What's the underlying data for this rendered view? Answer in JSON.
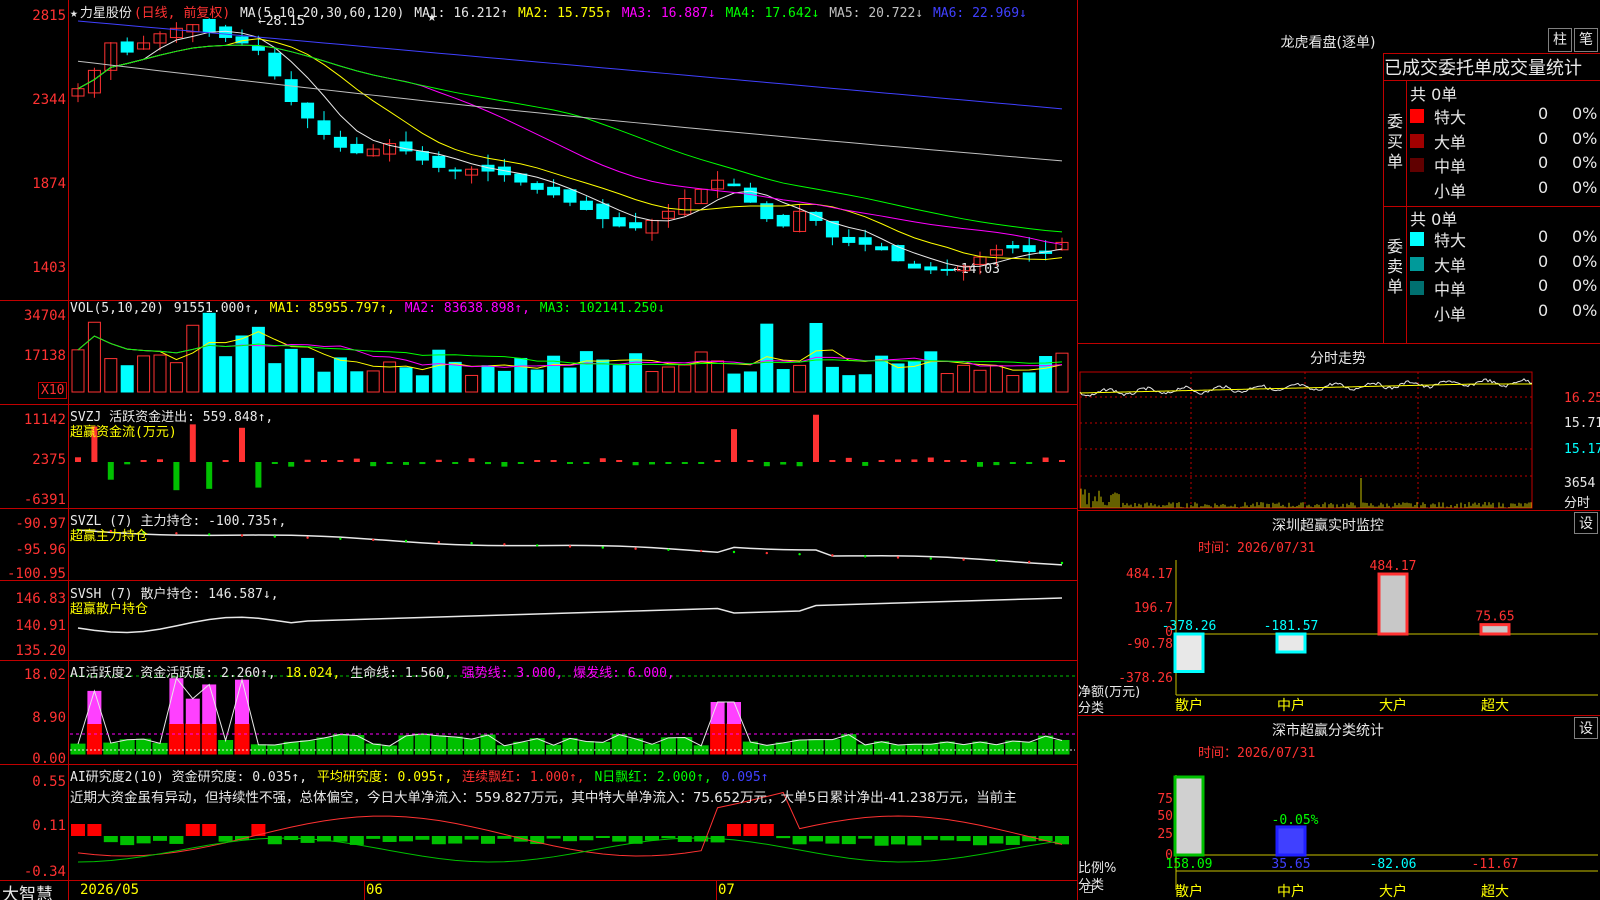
{
  "stock": {
    "star": "★",
    "name": "力星股份",
    "period": "(日线, 前复权)"
  },
  "main_panel": {
    "ma_title": "MA(5,10,20,30,60,120)",
    "ma": [
      {
        "label": "MA1:",
        "value": "16.212",
        "arrow": "↑",
        "color": "#e8e8e8"
      },
      {
        "label": "MA2:",
        "value": "15.755",
        "arrow": "↑",
        "color": "#ffff00"
      },
      {
        "label": "MA3:",
        "value": "16.887",
        "arrow": "↓",
        "color": "#ff00ff"
      },
      {
        "label": "MA4:",
        "value": "17.642",
        "arrow": "↓",
        "color": "#00ff00"
      },
      {
        "label": "MA5:",
        "value": "20.722",
        "arrow": "↓",
        "color": "#c0c0c0"
      },
      {
        "label": "MA6:",
        "value": "22.969",
        "arrow": "↓",
        "color": "#4040ff"
      }
    ],
    "yticks": [
      "2815",
      "2344",
      "1874",
      "1403"
    ],
    "high_mark": "←28.15",
    "low_mark": "←14.03",
    "flag_star": "★"
  },
  "vol_panel": {
    "header": [
      {
        "text": "VOL(5,10,20)",
        "color": "#e8e8e8"
      },
      {
        "text": "91551.000↑,",
        "color": "#e8e8e8"
      },
      {
        "text": "MA1: 85955.797↑,",
        "color": "#ffff00"
      },
      {
        "text": "MA2: 83638.898↑,",
        "color": "#ff00ff"
      },
      {
        "text": "MA3: 102141.250↓",
        "color": "#00ff00"
      }
    ],
    "yticks": [
      "34704",
      "17138"
    ],
    "unit": "X10"
  },
  "svzj_panel": {
    "header": [
      {
        "text": "SVZJ  活跃资金进出: 559.848↑,",
        "color": "#e8e8e8"
      }
    ],
    "sub": "超赢资金流(万元)",
    "yticks": [
      "11142",
      "2375",
      "-6391"
    ]
  },
  "svzl_panel": {
    "header": [
      {
        "text": "SVZL (7) 主力持仓: -100.735↑,",
        "color": "#e8e8e8"
      }
    ],
    "sub": "超赢主力持仓",
    "yticks": [
      "-90.97",
      "-95.96",
      "-100.95"
    ]
  },
  "svsh_panel": {
    "header": [
      {
        "text": "SVSH (7) 散户持仓: 146.587↓,",
        "color": "#e8e8e8"
      }
    ],
    "sub": "超赢散户持仓",
    "yticks": [
      "146.83",
      "140.91",
      "135.20"
    ]
  },
  "ai2_panel": {
    "header": [
      {
        "text": "AI活跃度2 资金活跃度: 2.260↑,",
        "color": "#e8e8e8"
      },
      {
        "text": "18.024,",
        "color": "#ffff00"
      },
      {
        "text": "生命线: 1.560,",
        "color": "#e8e8e8"
      },
      {
        "text": "强势线: 3.000,",
        "color": "#ff00ff"
      },
      {
        "text": "爆发线: 6.000,",
        "color": "#ff00ff"
      }
    ],
    "yticks": [
      "18.02",
      "8.90",
      "0.00"
    ]
  },
  "ai_research_panel": {
    "header": [
      {
        "text": "AI研究度2(10) 资金研究度: 0.035↑,",
        "color": "#e8e8e8"
      },
      {
        "text": "平均研究度: 0.095↑,",
        "color": "#ffff00"
      },
      {
        "text": "连续飘红: 1.000↑,",
        "color": "#ff3232"
      },
      {
        "text": "N日飘红: 2.000↑,",
        "color": "#00ff00"
      },
      {
        "text": "0.095↑",
        "color": "#4040ff"
      }
    ],
    "commentary": "近期大资金虽有异动，但持续性不强，总体偏空，今日大单净流入：559.827万元，其中特大单净流入：75.652万元，大单5日累计净出-41.238万元，当前主",
    "yticks": [
      "0.55",
      "0.11",
      "-0.34"
    ]
  },
  "date_axis": {
    "brand": "大智慧",
    "labels": [
      "2026/05",
      "06",
      "07"
    ]
  },
  "right": {
    "longhu": {
      "title": "龙虎看盘(逐单)",
      "btn_zhu": "柱",
      "btn_bi": "笔"
    },
    "tabs": {
      "t1": "已成交",
      "t2": "委托单",
      "t3": "成交量统计"
    },
    "buy": {
      "side": [
        "委",
        "买",
        "单"
      ],
      "total": "共 0单",
      "rows": [
        {
          "label": "特大",
          "count": "0",
          "pct": "0%",
          "color": "#ff0000"
        },
        {
          "label": "大单",
          "count": "0",
          "pct": "0%",
          "color": "#a00000"
        },
        {
          "label": "中单",
          "count": "0",
          "pct": "0%",
          "color": "#600000"
        },
        {
          "label": "小单",
          "count": "0",
          "pct": "0%",
          "color": ""
        }
      ]
    },
    "sell": {
      "side": [
        "委",
        "卖",
        "单"
      ],
      "total": "共 0单",
      "rows": [
        {
          "label": "特大",
          "count": "0",
          "pct": "0%",
          "color": "#00ffff"
        },
        {
          "label": "大单",
          "count": "0",
          "pct": "0%",
          "color": "#009a9a"
        },
        {
          "label": "中单",
          "count": "0",
          "pct": "0%",
          "color": "#007070"
        },
        {
          "label": "小单",
          "count": "0",
          "pct": "0%",
          "color": ""
        }
      ]
    },
    "intraday": {
      "title": "分时走势",
      "ylabels": [
        "16.25",
        "15.71",
        "15.17",
        "3654"
      ],
      "unit": "分时"
    },
    "monitor": {
      "title": "深圳超赢实时监控",
      "btn": "设",
      "time": "时间：2026/07/31",
      "yticks": [
        "484.17",
        "196.7",
        "0",
        "-90.78",
        "-378.26"
      ],
      "bars": [
        {
          "cat": "散户",
          "value": -378.26,
          "label": "-378.26"
        },
        {
          "cat": "中户",
          "value": -181.57,
          "label": "-181.57"
        },
        {
          "cat": "大户",
          "value": 484.17,
          "label": "484.17"
        },
        {
          "cat": "超大",
          "value": 75.65,
          "label": "75.65"
        }
      ],
      "ylabel": "净额(万元)",
      "xlabel": "分类"
    },
    "classify": {
      "title": "深市超赢分类统计",
      "btn": "设",
      "time": "时间：2026/07/31",
      "yticks": [
        "75",
        "50",
        "25",
        "0"
      ],
      "bars": [
        {
          "cat": "散户",
          "value": 158.09,
          "label": "158.09",
          "pct": 100
        },
        {
          "cat": "中户",
          "value": 35.65,
          "label": "35.65",
          "pct": 36
        },
        {
          "cat": "大户",
          "value": -82.06,
          "label": "-82.06",
          "pct": 0
        },
        {
          "cat": "超大",
          "value": -11.67,
          "label": "-11.67",
          "pct": 0
        }
      ],
      "note": "-0.05%",
      "ylabel": "比例%",
      "xlabel": "分类"
    }
  },
  "colors": {
    "up": "#ff3232",
    "down": "#00ffff",
    "grid": "#c00000"
  }
}
